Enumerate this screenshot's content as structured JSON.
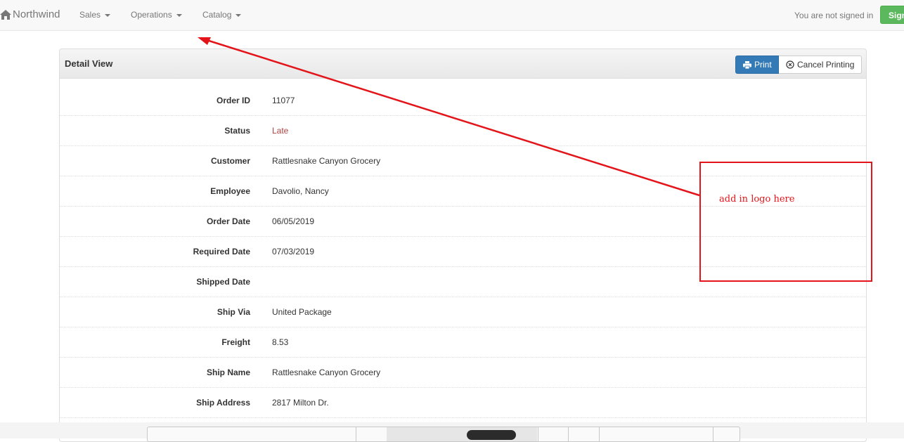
{
  "navbar": {
    "brand": "Northwind",
    "brand_icon": "home-icon",
    "menus": [
      {
        "label": "Sales"
      },
      {
        "label": "Operations"
      },
      {
        "label": "Catalog"
      }
    ],
    "signed_in_text": "You are not signed in",
    "sign_in_label": "Sign"
  },
  "panel": {
    "title": "Detail View",
    "print_label": "Print",
    "cancel_label": "Cancel Printing"
  },
  "fields": [
    {
      "label": "Order ID",
      "value": "11077"
    },
    {
      "label": "Status",
      "value": "Late"
    },
    {
      "label": "Customer",
      "value": "Rattlesnake Canyon Grocery"
    },
    {
      "label": "Employee",
      "value": "Davolio, Nancy"
    },
    {
      "label": "Order Date",
      "value": "06/05/2019"
    },
    {
      "label": "Required Date",
      "value": "07/03/2019"
    },
    {
      "label": "Shipped Date",
      "value": ""
    },
    {
      "label": "Ship Via",
      "value": "United Package"
    },
    {
      "label": "Freight",
      "value": "8.53"
    },
    {
      "label": "Ship Name",
      "value": "Rattlesnake Canyon Grocery"
    },
    {
      "label": "Ship Address",
      "value": "2817 Milton Dr."
    }
  ],
  "annotation": {
    "text": "add in logo here",
    "color": "#e3151a"
  },
  "colors": {
    "primary": "#337ab7",
    "success": "#5cb85c",
    "late": "#a94442"
  }
}
